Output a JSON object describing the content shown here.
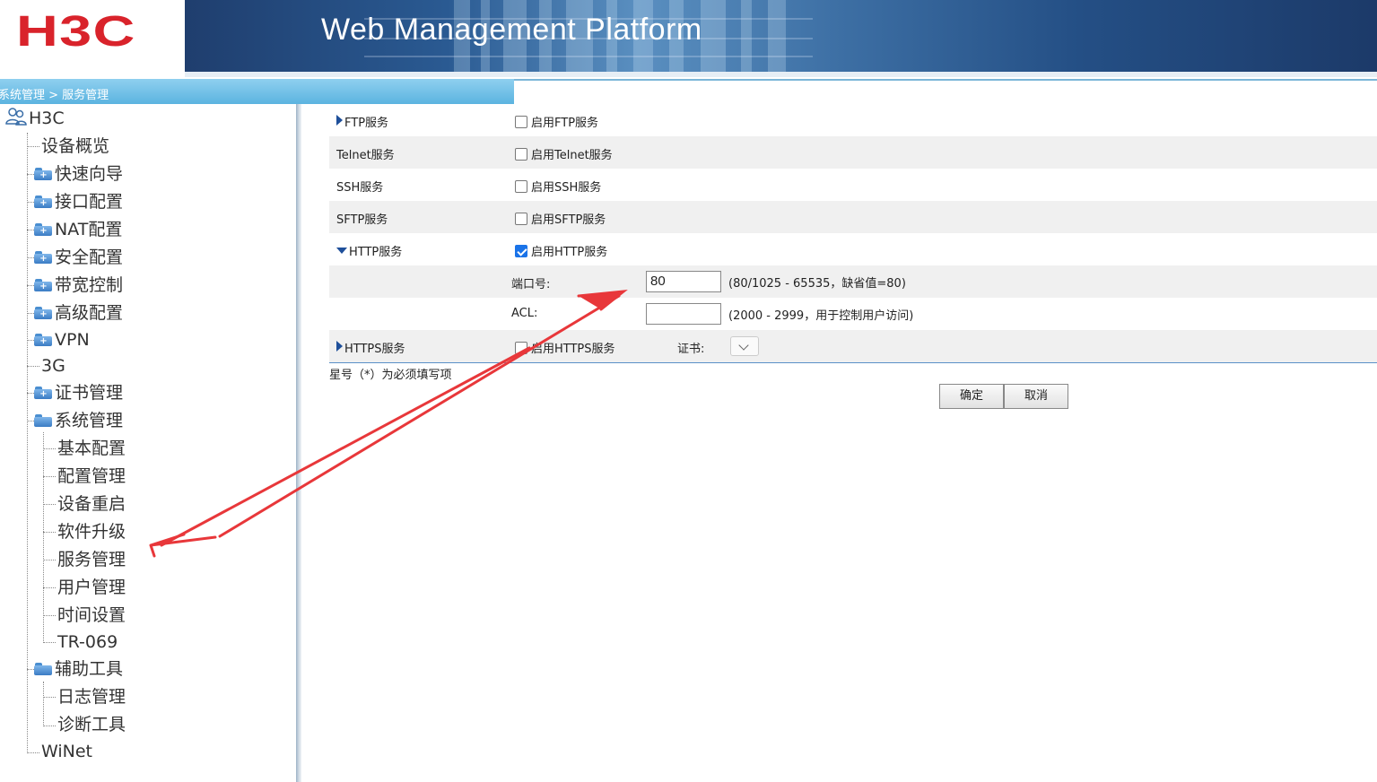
{
  "header": {
    "logo_text": "H3C",
    "banner_title": "Web Management Platform"
  },
  "breadcrumb": "系统管理 > 服务管理",
  "sidebar": {
    "root": "H3C",
    "items": [
      {
        "label": "设备概览",
        "icon": "none"
      },
      {
        "label": "快速向导",
        "icon": "folder-plus-icon"
      },
      {
        "label": "接口配置",
        "icon": "folder-plus-icon"
      },
      {
        "label": "NAT配置",
        "icon": "folder-plus-icon"
      },
      {
        "label": "安全配置",
        "icon": "folder-plus-icon"
      },
      {
        "label": "带宽控制",
        "icon": "folder-plus-icon"
      },
      {
        "label": "高级配置",
        "icon": "folder-plus-icon"
      },
      {
        "label": "VPN",
        "icon": "folder-plus-icon"
      },
      {
        "label": "3G",
        "icon": "none"
      },
      {
        "label": "证书管理",
        "icon": "folder-plus-icon"
      },
      {
        "label": "系统管理",
        "icon": "folder-open-icon"
      },
      {
        "label": "辅助工具",
        "icon": "folder-open-icon"
      },
      {
        "label": "WiNet",
        "icon": "none"
      }
    ],
    "system_children": [
      "基本配置",
      "配置管理",
      "设备重启",
      "软件升级",
      "服务管理",
      "用户管理",
      "时间设置",
      "TR-069"
    ],
    "tools_children": [
      "日志管理",
      "诊断工具"
    ]
  },
  "services": {
    "ftp": {
      "label": "FTP服务",
      "option": "启用FTP服务",
      "checked": false
    },
    "telnet": {
      "label": "Telnet服务",
      "option": "启用Telnet服务",
      "checked": false
    },
    "ssh": {
      "label": "SSH服务",
      "option": "启用SSH服务",
      "checked": false
    },
    "sftp": {
      "label": "SFTP服务",
      "option": "启用SFTP服务",
      "checked": false
    },
    "http": {
      "label": "HTTP服务",
      "option": "启用HTTP服务",
      "checked": true,
      "port_label": "端口号:",
      "port_value": "80",
      "port_hint": "(80/1025 - 65535，缺省值=80)",
      "acl_label": "ACL:",
      "acl_value": "",
      "acl_hint": "(2000 - 2999，用于控制用户访问)"
    },
    "https": {
      "label": "HTTPS服务",
      "option": "启用HTTPS服务",
      "checked": false,
      "cert_label": "证书:"
    }
  },
  "required_note": "星号（*）为必须填写项",
  "buttons": {
    "ok": "确定",
    "cancel": "取消"
  },
  "colors": {
    "brand_red": "#d9232b",
    "annotation_arrow": "#e8373a",
    "breadcrumb_bar": "#6fc1e8"
  }
}
